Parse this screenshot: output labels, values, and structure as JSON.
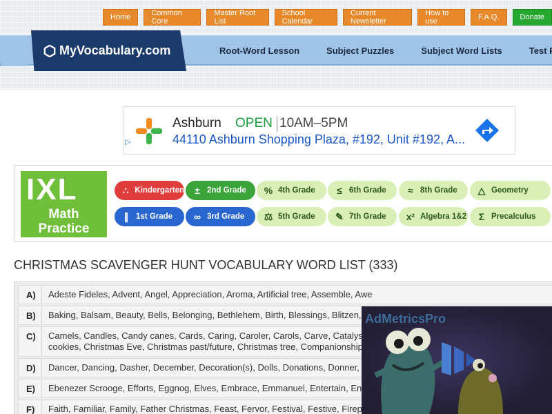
{
  "topnav": [
    {
      "label": "Home"
    },
    {
      "label": "Common Core"
    },
    {
      "label": "Master Root List"
    },
    {
      "label": "School Calendar"
    },
    {
      "label": "Current Newsletter"
    },
    {
      "label": "How to use"
    },
    {
      "label": "F.A.Q."
    },
    {
      "label": "Donate"
    }
  ],
  "logo": {
    "text": "MyVocabulary.com",
    "icon": "hexagon-icon"
  },
  "mainnav": [
    {
      "label": "Root-Word Lesson"
    },
    {
      "label": "Subject Puzzles"
    },
    {
      "label": "Subject Word Lists"
    },
    {
      "label": "Test Prep"
    }
  ],
  "location_ad": {
    "city": "Ashburn",
    "status": "OPEN",
    "hours": "10AM–5PM",
    "address": "44110 Ashburn Shopping Plaza, #192, Unit #192, A...",
    "icon": "pharmacy-cross-icon",
    "directions_icon": "directions-arrow-icon",
    "status_color": "#1e9b3e"
  },
  "ixl": {
    "logo": "IXL",
    "subtitle_line1": "Math",
    "subtitle_line2": "Practice",
    "grades": [
      {
        "label": "Kindergarten",
        "icon": "dots-icon",
        "bg": "#e03d3d",
        "fg": "#ffffff"
      },
      {
        "label": "2nd Grade",
        "icon": "plus-minus-icon",
        "bg": "#3aa339",
        "fg": "#ffffff"
      },
      {
        "label": "4th Grade",
        "icon": "percent-icon",
        "bg": "#d9efb5",
        "fg": "#2c5a1c"
      },
      {
        "label": "6th Grade",
        "icon": "less-equal-icon",
        "bg": "#d9efb5",
        "fg": "#2c5a1c"
      },
      {
        "label": "8th Grade",
        "icon": "approx-icon",
        "bg": "#d9efb5",
        "fg": "#2c5a1c"
      },
      {
        "label": "Geometry",
        "icon": "triangle-icon",
        "bg": "#d9efb5",
        "fg": "#2c5a1c"
      },
      {
        "label": "1st Grade",
        "icon": "tally-icon",
        "bg": "#2a66d0",
        "fg": "#ffffff"
      },
      {
        "label": "3rd Grade",
        "icon": "infinity-icon",
        "bg": "#2a66d0",
        "fg": "#ffffff"
      },
      {
        "label": "5th Grade",
        "icon": "scale-icon",
        "bg": "#d9efb5",
        "fg": "#2c5a1c"
      },
      {
        "label": "7th Grade",
        "icon": "pencil-icon",
        "bg": "#d9efb5",
        "fg": "#2c5a1c"
      },
      {
        "label": "Algebra 1&2",
        "icon": "x-squared-icon",
        "bg": "#d9efb5",
        "fg": "#2c5a1c"
      },
      {
        "label": "Precalculus",
        "icon": "sigma-icon",
        "bg": "#d9efb5",
        "fg": "#2c5a1c"
      }
    ]
  },
  "list": {
    "title": "CHRISTMAS SCAVENGER HUNT VOCABULARY WORD LIST (333)",
    "rows": [
      {
        "letter": "A)",
        "words": "Adeste Fideles, Advent, Angel, Appreciation, Aroma, Artificial tree, Assemble, Awe"
      },
      {
        "letter": "B)",
        "words": "Baking, Balsam, Beauty, Bells, Belonging, Bethlehem, Birth, Blessings, Blitzen, Bough"
      },
      {
        "letter": "C)",
        "words": "Camels, Candles, Candy canes, Cards, Caring, Caroler, Carols, Carve, Catalyst, Celebrate, Christian, Christmas, Christmas cookies, Christmas Eve, Christmas past/future, Christmas tree, Companionship, Cornucopia, Cranberries, Creche, Crowds"
      },
      {
        "letter": "D)",
        "words": "Dancer, Dancing, Dasher, December, Decoration(s), Dolls, Donations, Donner, Dreams"
      },
      {
        "letter": "E)",
        "words": "Ebenezer Scrooge, Efforts, Eggnog, Elves, Embrace, Emmanuel, Entertain, Entertainment"
      },
      {
        "letter": "F)",
        "words": "Faith, Familiar, Family, Father Christmas, Feast, Fervor, Festival, Festive, Fireplace, Frankincense, Friendship, Frosty the Snowman, Fruitcake"
      }
    ]
  },
  "video_ad": {
    "brand": "AdMetricsPro"
  }
}
